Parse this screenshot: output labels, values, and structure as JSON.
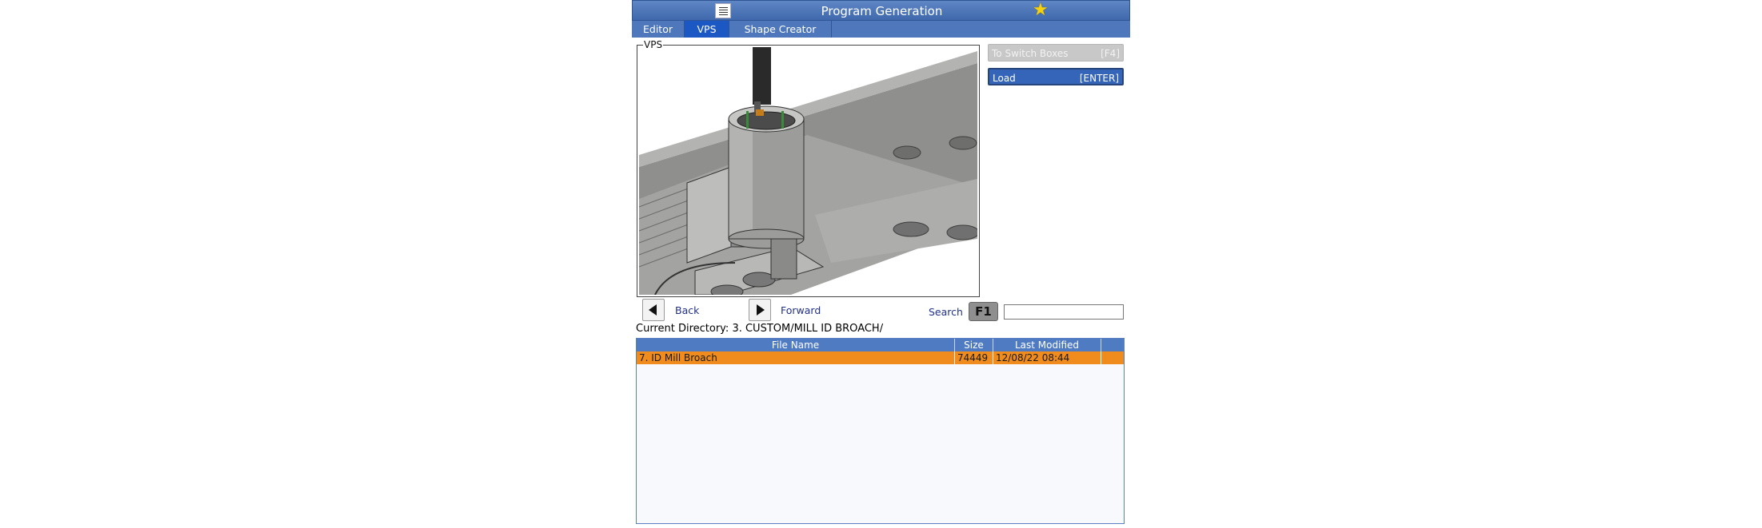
{
  "window": {
    "title": "Program Generation",
    "menu_icon": "menu-icon",
    "favorite_icon": "star-icon"
  },
  "tabs": [
    {
      "label": "Editor",
      "active": false
    },
    {
      "label": "VPS",
      "active": true
    },
    {
      "label": "Shape Creator",
      "active": false
    }
  ],
  "vps": {
    "label": "VPS",
    "image": "3D render of ID broach tool inserted into a cylindrical part mounted on a fixture plate"
  },
  "side_buttons": {
    "switch": {
      "label": "To Switch Boxes",
      "key": "[F4]"
    },
    "load": {
      "label": "Load",
      "key": "[ENTER]"
    }
  },
  "nav": {
    "back_label": "Back",
    "forward_label": "Forward"
  },
  "search": {
    "label": "Search",
    "key": "F1",
    "value": "",
    "placeholder": ""
  },
  "current_directory": "Current Directory: 3. CUSTOM/MILL ID BROACH/",
  "table": {
    "columns": [
      "File Name",
      "Size",
      "Last Modified",
      ""
    ],
    "rows": [
      {
        "name": "7. ID Mill Broach",
        "size": "74449",
        "modified": "12/08/22 08:44",
        "extra": "",
        "selected": true
      }
    ]
  },
  "colors": {
    "accent": "#3f69ad",
    "selected_row": "#f08c1e",
    "active_tab": "#1c58c4"
  }
}
